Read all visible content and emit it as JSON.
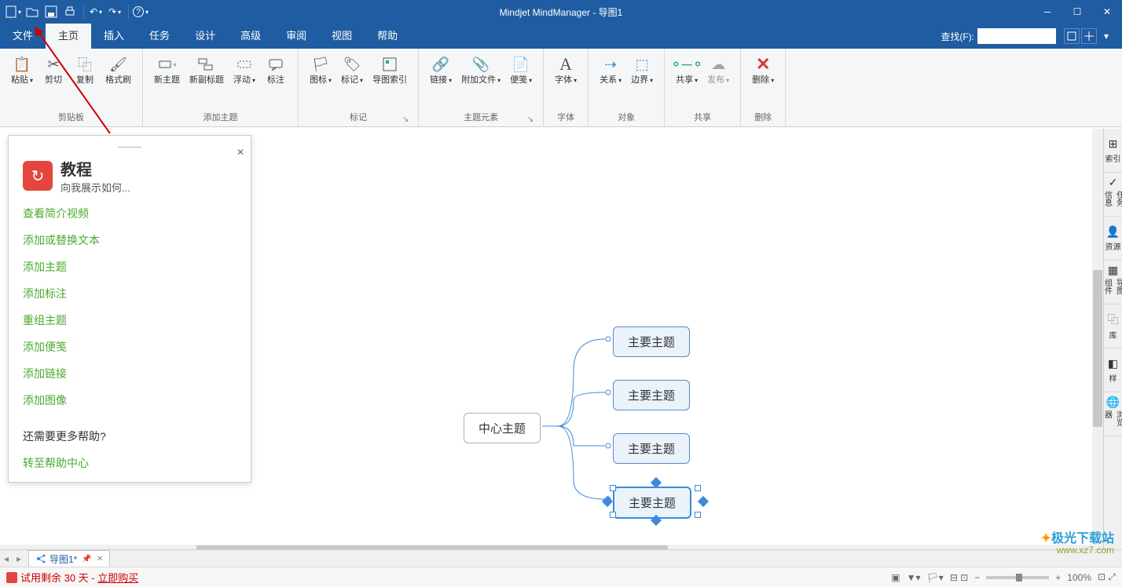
{
  "title": "Mindjet MindManager - 导图1",
  "menus": {
    "file": "文件",
    "home": "主页",
    "insert": "插入",
    "task": "任务",
    "design": "设计",
    "advanced": "高级",
    "review": "审阅",
    "view": "视图",
    "help": "帮助"
  },
  "search_label": "查找(F):",
  "ribbon": {
    "clipboard": {
      "paste": "粘贴",
      "cut": "剪切",
      "copy": "复制",
      "fmt": "格式刷",
      "group": "剪贴板"
    },
    "addtopic": {
      "newtopic": "新主题",
      "newsub": "新副标题",
      "float": "浮动",
      "callout": "标注",
      "group": "添加主题"
    },
    "markers": {
      "icon": "图标",
      "tag": "标记",
      "index": "导图索引",
      "group": "标记"
    },
    "elements": {
      "link": "链接",
      "attach": "附加文件",
      "note": "便笺",
      "group": "主题元素"
    },
    "font": {
      "font": "字体",
      "group": "字体"
    },
    "object": {
      "rel": "关系",
      "boundary": "边界",
      "group": "对象"
    },
    "share": {
      "share": "共享",
      "publish": "发布",
      "group": "共享"
    },
    "delete": {
      "del": "删除",
      "group": "删除"
    }
  },
  "panel": {
    "title": "教程",
    "subtitle": "向我展示如何...",
    "links": [
      "查看简介视频",
      "添加或替换文本",
      "添加主题",
      "添加标注",
      "重组主题",
      "添加便笺",
      "添加链接",
      "添加图像"
    ],
    "help_q": "还需要更多帮助?",
    "help_link": "转至帮助中心"
  },
  "map": {
    "center": "中心主题",
    "main": "主要主题"
  },
  "sidepanel": [
    "索引",
    "任务信息",
    "资源",
    "导图组件",
    "库",
    "样",
    "浏览器"
  ],
  "doctab": "导图1*",
  "trial": {
    "label": "试用剩余 30 天 - ",
    "buy": "立即购买"
  },
  "zoom": "100%",
  "watermark": {
    "name": "极光下载站",
    "url": "www.xz7.com"
  }
}
